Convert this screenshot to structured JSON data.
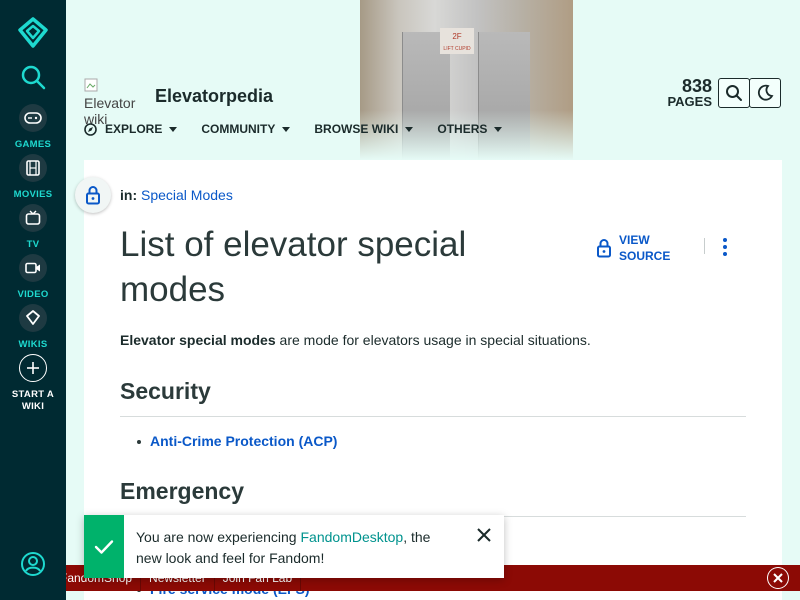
{
  "global_nav": {
    "items": [
      {
        "label": "GAMES",
        "icon": "gamepad-icon"
      },
      {
        "label": "MOVIES",
        "icon": "film-icon"
      },
      {
        "label": "TV",
        "icon": "tv-icon"
      },
      {
        "label": "VIDEO",
        "icon": "video-icon"
      },
      {
        "label": "WIKIS",
        "icon": "fandom-heart-icon"
      }
    ],
    "start_wiki": {
      "line1": "START A",
      "line2": "WIKI"
    }
  },
  "hero": {
    "sign_line1": "2F",
    "sign_line2": "LIFT CUPID"
  },
  "wiki": {
    "logo_alt": "Elevator wiki",
    "name": "Elevatorpedia",
    "page_count": "838",
    "page_count_label": "PAGES",
    "nav": [
      {
        "label": "EXPLORE",
        "icon": "explore-icon"
      },
      {
        "label": "COMMUNITY"
      },
      {
        "label": "BROWSE WIKI"
      },
      {
        "label": "OTHERS"
      }
    ]
  },
  "article": {
    "breadcrumb_prefix": "in:",
    "breadcrumb_link": "Special Modes",
    "title": "List of elevator special modes",
    "view_source_line1": "VIEW",
    "view_source_line2": "SOURCE",
    "intro_bold": "Elevator special modes",
    "intro_rest": " are mode for elevators usage in special situations.",
    "sections": [
      {
        "heading": "Security",
        "items": [
          "Anti-Crime Protection (ACP)"
        ]
      },
      {
        "heading": "Emergency",
        "items": [
          "Fire service mode (EFS)"
        ]
      }
    ]
  },
  "toast": {
    "text_before": "You are now experiencing ",
    "link": "FandomDesktop",
    "text_after": ", the new look and feel for Fandom!"
  },
  "bottom_bar": {
    "links": [
      "FandomShop",
      "Newsletter",
      "Join Fan Lab"
    ]
  },
  "colors": {
    "nav_bg": "#002a32",
    "accent_teal": "#1ed9cf",
    "link_blue": "#0a58c8",
    "toast_green": "#00b26b",
    "bottom_bar": "#8c0a05"
  }
}
